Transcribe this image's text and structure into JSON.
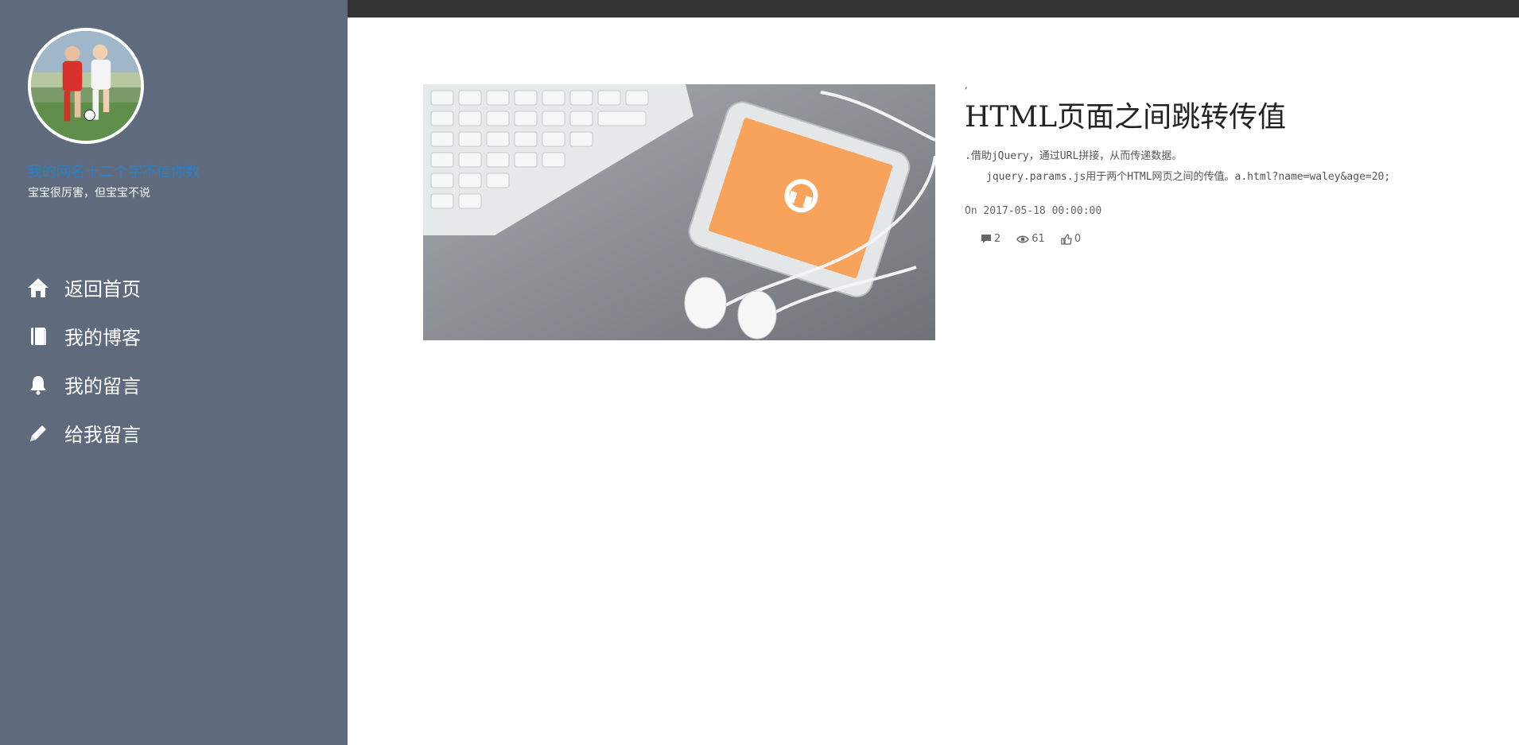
{
  "sidebar": {
    "site_name": "我的网名十二个字不信你数",
    "motto": "宝宝很厉害，但宝宝不说",
    "nav": [
      {
        "icon": "home-icon",
        "label": "返回首页"
      },
      {
        "icon": "book-icon",
        "label": "我的博客"
      },
      {
        "icon": "bell-icon",
        "label": "我的留言"
      },
      {
        "icon": "pencil-icon",
        "label": "给我留言"
      }
    ]
  },
  "post": {
    "tick": ",",
    "title": "HTML页面之间跳转传值",
    "excerpt_line1": ".借助jQuery，通过URL拼接，从而传递数据。",
    "excerpt_line2": "jquery.params.js用于两个HTML网页之间的传值。a.html?name=waley&age=20;",
    "date": "On 2017-05-18 00:00:00",
    "comments": "2",
    "views": "61",
    "likes": "0"
  },
  "colors": {
    "sidebar_bg": "#5f6b7d",
    "topbar_bg": "#333333",
    "site_name": "#2f7fc0",
    "phone_screen": "#f8a35c"
  }
}
